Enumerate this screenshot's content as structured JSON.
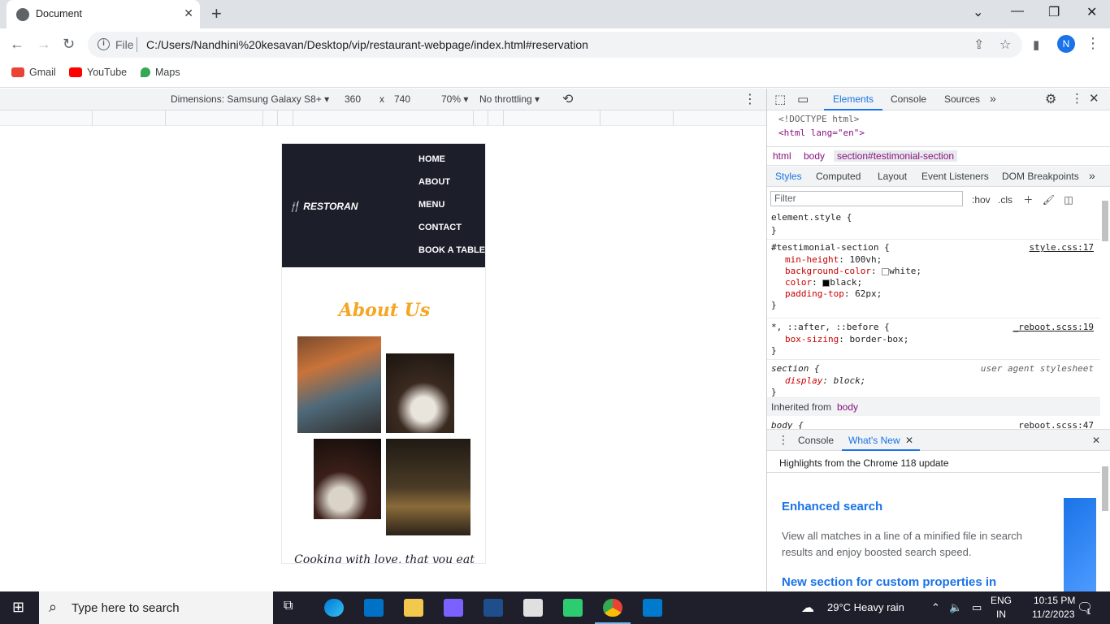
{
  "browser": {
    "tab_title": "Document",
    "url_scheme_label": "File",
    "url": "C:/Users/Nandhini%20kesavan/Desktop/vip/restaurant-webpage/index.html#reservation",
    "profile_initial": "N",
    "bookmarks": [
      "Gmail",
      "YouTube",
      "Maps"
    ]
  },
  "device_toolbar": {
    "dimensions": "Dimensions: Samsung Galaxy S8+",
    "width": "360",
    "x": "x",
    "height": "740",
    "zoom": "70%",
    "throttling": "No throttling"
  },
  "site": {
    "brand": "RESTORAN",
    "nav": [
      "HOME",
      "ABOUT",
      "MENU",
      "CONTACT",
      "BOOK A TABLE"
    ],
    "section_title": "About Us",
    "tagline": "Cooking with love, that you eat"
  },
  "devtools": {
    "tabs": [
      "Elements",
      "Console",
      "Sources"
    ],
    "dom_lines": [
      "<!DOCTYPE html>",
      "<html lang=\"en\">"
    ],
    "breadcrumbs": [
      "html",
      "body",
      "section#testimonial-section"
    ],
    "subtabs": [
      "Styles",
      "Computed",
      "Layout",
      "Event Listeners",
      "DOM Breakpoints"
    ],
    "filter_placeholder": "Filter",
    "hov": ":hov",
    "cls": ".cls",
    "rules": {
      "element_style": "element.style {",
      "close": "}",
      "testimonial_selector": "#testimonial-section {",
      "testimonial_src": "style.css:17",
      "p1_name": "min-height",
      "p1_val": "100vh;",
      "p2_name": "background-color",
      "p2_val": "white;",
      "p3_name": "color",
      "p3_val": "black;",
      "p4_name": "padding-top",
      "p4_val": "62px;",
      "universal_selector": "*, ::after, ::before {",
      "universal_src": "_reboot.scss:19",
      "p5_name": "box-sizing",
      "p5_val": "border-box;",
      "section_selector": "section {",
      "section_src": "user agent stylesheet",
      "p6_name": "display",
      "p6_val": "block;",
      "inherited_label": "Inherited from",
      "inherited_from": "body",
      "body_selector": "body {",
      "body_src": "_reboot.scss:47"
    },
    "drawer_tabs": [
      "Console",
      "What's New"
    ],
    "whats_new_highlight": "Highlights from the Chrome 118 update",
    "whats_new_title1": "Enhanced search",
    "whats_new_text1": "View all matches in a line of a minified file in search results and enjoy boosted search speed.",
    "whats_new_title2": "New section for custom properties in"
  },
  "taskbar": {
    "search_placeholder": "Type here to search",
    "weather": "29°C  Heavy rain",
    "lang": "ENG",
    "region": "IN",
    "time": "10:15 PM",
    "date": "11/2/2023",
    "notification_count": "1"
  },
  "colors": {
    "accent": "#1a73e8",
    "site_nav_bg": "#1c1e2a",
    "site_accent": "#f5a623"
  }
}
